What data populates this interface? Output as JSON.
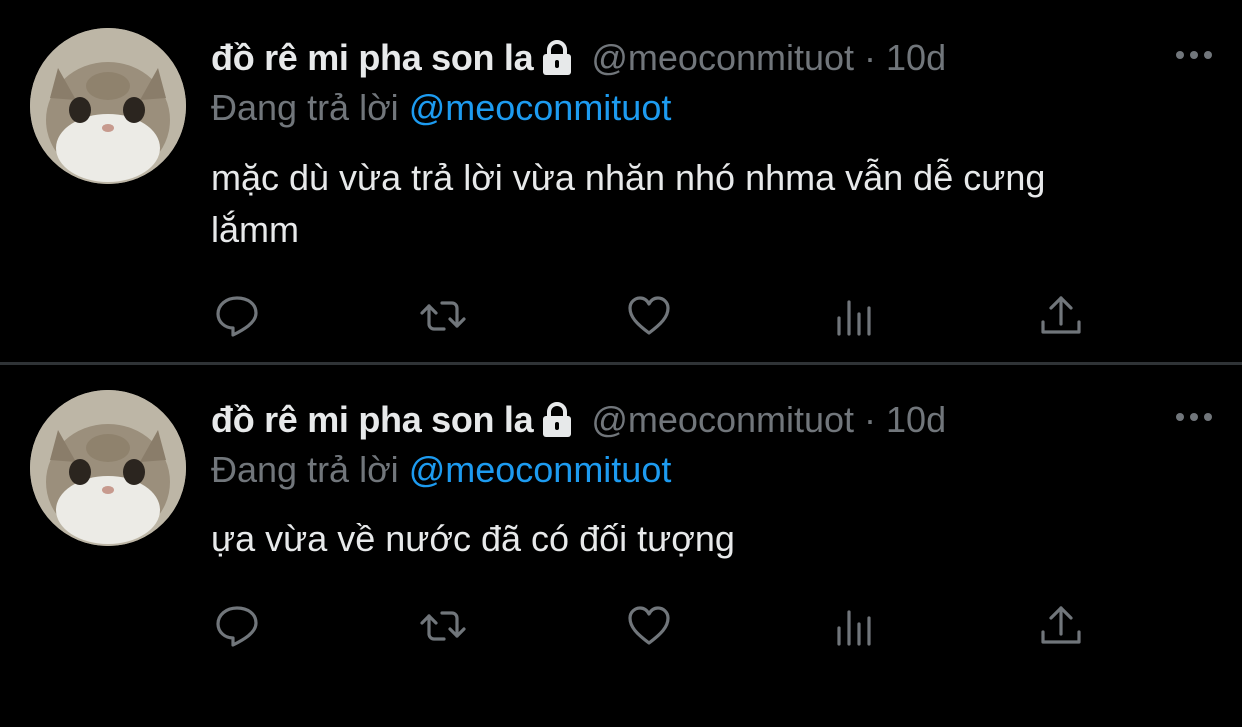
{
  "tweets": [
    {
      "display_name": "đồ rê mi pha son la",
      "handle": "@meoconmituot",
      "separator": "·",
      "time": "10d",
      "reply_prefix": "Đang trả lời",
      "reply_to": "@meoconmituot",
      "text": "mặc dù vừa trả lời vừa nhăn nhó nhma vẫn dễ cưng lắmm"
    },
    {
      "display_name": "đồ rê mi pha son la",
      "handle": "@meoconmituot",
      "separator": "·",
      "time": "10d",
      "reply_prefix": "Đang trả lời",
      "reply_to": "@meoconmituot",
      "text": "ựa vừa về nước đã có đối tượng"
    }
  ],
  "icons": [
    "lock-icon",
    "more-icon",
    "reply-icon",
    "retweet-icon",
    "like-icon",
    "views-icon",
    "share-icon"
  ],
  "colors": {
    "background": "#000000",
    "text": "#e7e9ea",
    "secondary": "#71767b",
    "link": "#1d9bf0",
    "divider": "#2f3336"
  }
}
